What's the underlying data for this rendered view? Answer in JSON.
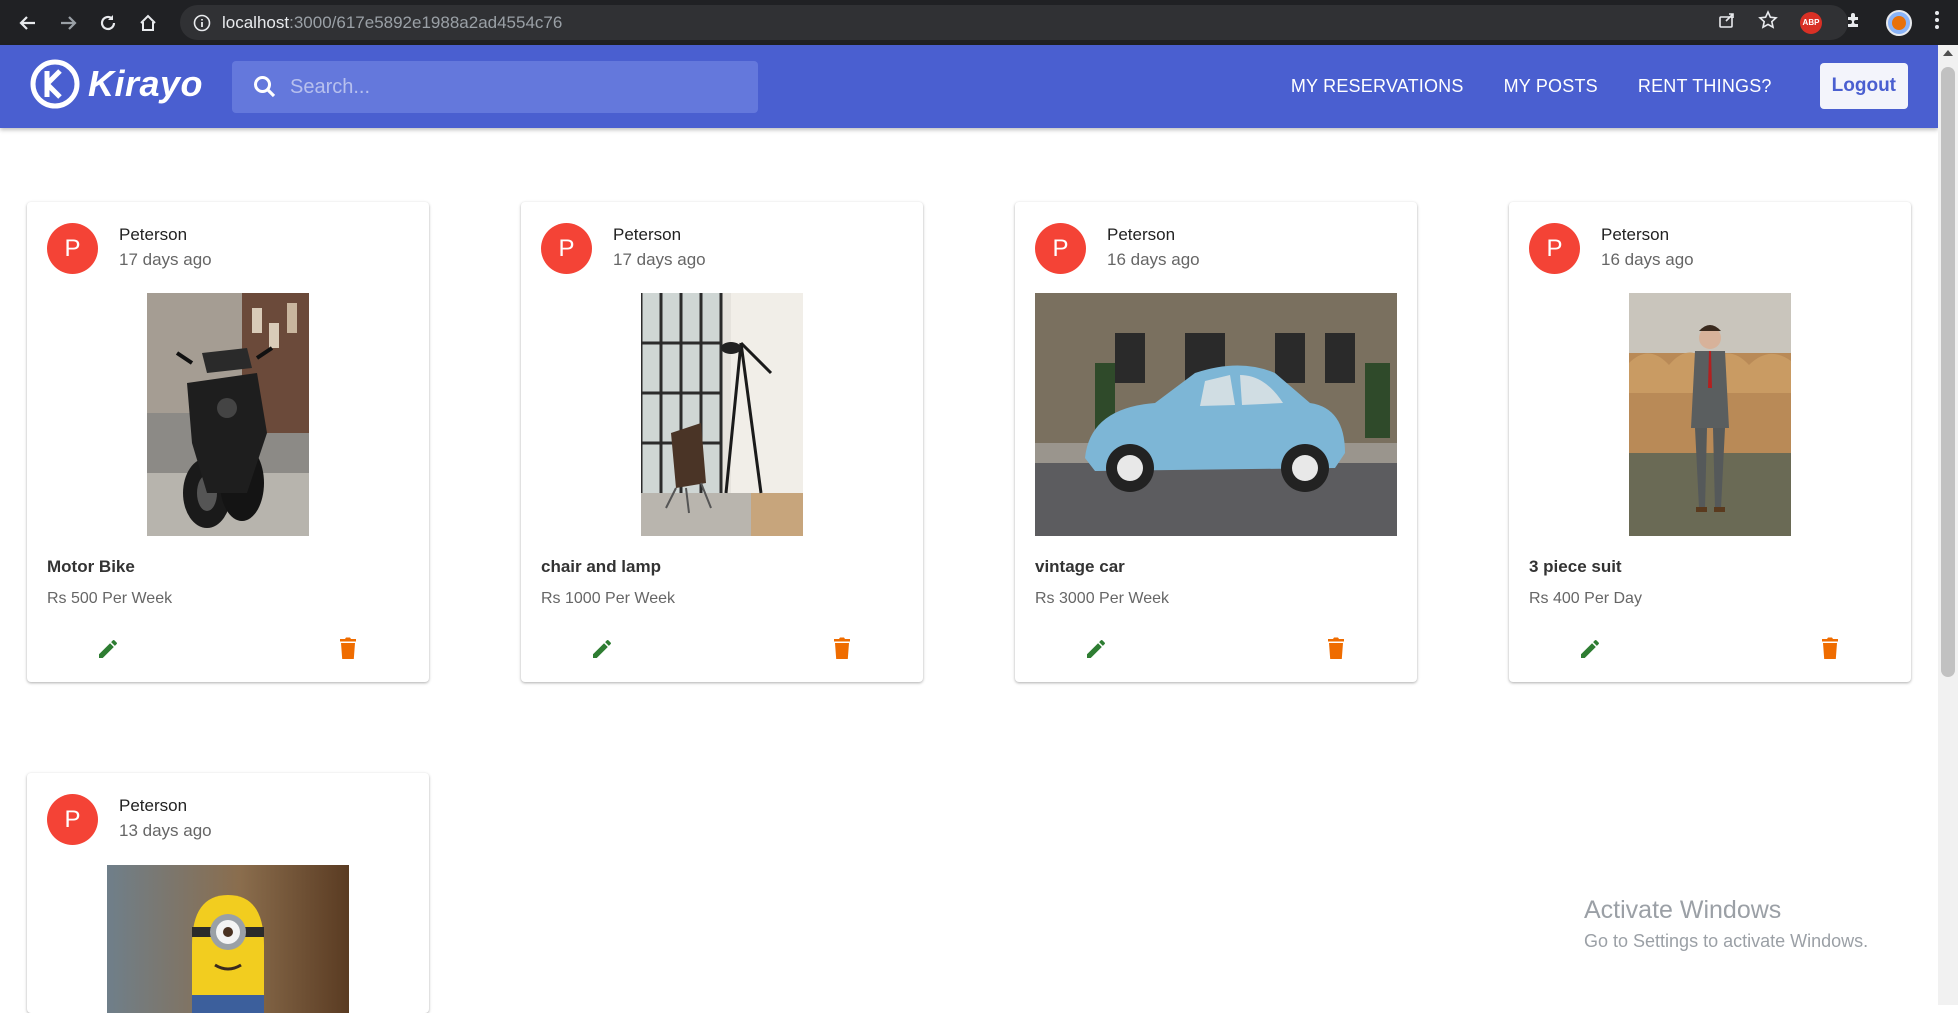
{
  "browser": {
    "url_host": "localhost",
    "url_rest": ":3000/617e5892e1988a2ad4554c76",
    "extension_abp": "ABP"
  },
  "app": {
    "logo_text": "Kirayo",
    "search_placeholder": "Search...",
    "nav": {
      "reservations": "MY RESERVATIONS",
      "posts": "MY POSTS",
      "rent": "RENT THINGS?",
      "logout": "Logout"
    },
    "colors": {
      "primary": "#4a5fd0",
      "avatar": "#f44336",
      "edit": "#2e7d32",
      "delete": "#ef6c00"
    }
  },
  "posts": [
    {
      "avatar_letter": "P",
      "author": "Peterson",
      "time": "17 days ago",
      "title": "Motor Bike",
      "price": "Rs 500 Per Week",
      "image": "motorbike"
    },
    {
      "avatar_letter": "P",
      "author": "Peterson",
      "time": "17 days ago",
      "title": "chair and lamp",
      "price": "Rs 1000 Per Week",
      "image": "chair-lamp"
    },
    {
      "avatar_letter": "P",
      "author": "Peterson",
      "time": "16 days ago",
      "title": "vintage car",
      "price": "Rs 3000 Per Week",
      "image": "blue-car"
    },
    {
      "avatar_letter": "P",
      "author": "Peterson",
      "time": "16 days ago",
      "title": "3 piece suit",
      "price": "Rs 400 Per Day",
      "image": "suit"
    },
    {
      "avatar_letter": "P",
      "author": "Peterson",
      "time": "13 days ago",
      "image": "minion"
    }
  ],
  "watermark": {
    "title": "Activate Windows",
    "subtitle": "Go to Settings to activate Windows."
  }
}
